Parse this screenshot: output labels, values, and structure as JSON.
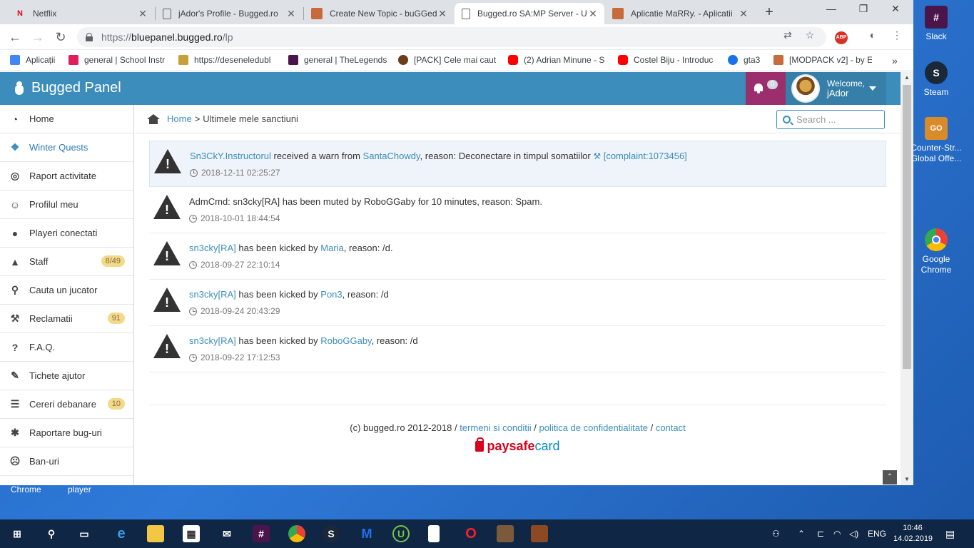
{
  "browser": {
    "tabs": [
      {
        "title": "Netflix",
        "favicon": "netflix-icon",
        "color": "#e50914",
        "active": false
      },
      {
        "title": "jAdor's Profile - Bugged.ro",
        "favicon": "page-icon",
        "color": "#5f6368",
        "active": false
      },
      {
        "title": "Create New Topic - buGGed",
        "favicon": "bugged-icon",
        "color": "#c86b3c",
        "active": false
      },
      {
        "title": "Bugged.ro SA:MP Server - U",
        "favicon": "page-icon",
        "color": "#5f6368",
        "active": true
      },
      {
        "title": "Aplicatie MaRRy. - Aplicatii",
        "favicon": "bugged-icon",
        "color": "#c86b3c",
        "active": false
      }
    ],
    "url_host": "bluepanel.bugged.ro",
    "url_path": "/lp",
    "url_scheme": "https://",
    "bookmarks": [
      {
        "label": "Aplicații",
        "color": "#4285f4"
      },
      {
        "label": "general | School Instr",
        "color": "#e01e5a"
      },
      {
        "label": "https://deseneledubl",
        "color": "#c8a03a"
      },
      {
        "label": "general | TheLegends",
        "color": "#4a154b"
      },
      {
        "label": "[PACK] Cele mai caut",
        "color": "#6b3d1a"
      },
      {
        "label": "(2) Adrian Minune - S",
        "color": "#ff0000"
      },
      {
        "label": "Costel Biju - Introduc",
        "color": "#ff0000"
      },
      {
        "label": "gta3",
        "color": "#1a73e8"
      },
      {
        "label": "[MODPACK v2] - by E",
        "color": "#c86b3c"
      }
    ]
  },
  "header": {
    "brand": "Bugged Panel",
    "notifications_count": "0",
    "welcome": "Welcome,",
    "username": "jAdor"
  },
  "sidebar": {
    "items": [
      {
        "label": "Home",
        "icon": "dashboard-icon",
        "glyph": "◔",
        "badge": ""
      },
      {
        "label": "Winter Quests",
        "icon": "dropbox-icon",
        "glyph": "❖",
        "badge": "",
        "active": true
      },
      {
        "label": "Raport activitate",
        "icon": "target-icon",
        "glyph": "◎",
        "badge": ""
      },
      {
        "label": "Profilul meu",
        "icon": "smile-icon",
        "glyph": "☺",
        "badge": ""
      },
      {
        "label": "Playeri conectati",
        "icon": "user-icon",
        "glyph": "●",
        "badge": ""
      },
      {
        "label": "Staff",
        "icon": "android-icon",
        "glyph": "▲",
        "badge": "8/49"
      },
      {
        "label": "Cauta un jucator",
        "icon": "search-icon",
        "glyph": "⚲",
        "badge": ""
      },
      {
        "label": "Reclamatii",
        "icon": "gavel-icon",
        "glyph": "⚒",
        "badge": "91"
      },
      {
        "label": "F.A.Q.",
        "icon": "question-icon",
        "glyph": "?",
        "badge": ""
      },
      {
        "label": "Tichete ajutor",
        "icon": "ticket-icon",
        "glyph": "✎",
        "badge": ""
      },
      {
        "label": "Cereri debanare",
        "icon": "list-icon",
        "glyph": "☰",
        "badge": "10"
      },
      {
        "label": "Raportare bug-uri",
        "icon": "bug-icon",
        "glyph": "✱",
        "badge": ""
      },
      {
        "label": "Ban-uri",
        "icon": "frown-icon",
        "glyph": "☹",
        "badge": ""
      }
    ]
  },
  "breadcrumb": {
    "home": "Home",
    "separator": ">",
    "current": "Ultimele mele sanctiuni"
  },
  "search": {
    "placeholder": "Search ..."
  },
  "entries": [
    {
      "pre_link": "Sn3CkY.Instructorul",
      "mid": " received a warn from ",
      "link2": "SantaChowdy",
      "post": ", reason: Deconectare in timpul somatiilor ",
      "complaint": "[complaint:1073456]",
      "time": "2018-12-11 02:25:27",
      "highlight": true
    },
    {
      "pre_link": "",
      "mid": "AdmCmd: sn3cky[RA] has been muted by RoboGGaby for 10 minutes, reason: Spam.",
      "link2": "",
      "post": "",
      "complaint": "",
      "time": "2018-10-01 18:44:54",
      "highlight": false
    },
    {
      "pre_link": "sn3cky[RA]",
      "mid": " has been kicked by ",
      "link2": "Maria",
      "post": ", reason: /d.",
      "complaint": "",
      "time": "2018-09-27 22:10:14",
      "highlight": false
    },
    {
      "pre_link": "sn3cky[RA]",
      "mid": " has been kicked by ",
      "link2": "Pon3",
      "post": ", reason: /d",
      "complaint": "",
      "time": "2018-09-24 20:43:29",
      "highlight": false
    },
    {
      "pre_link": "sn3cky[RA]",
      "mid": " has been kicked by ",
      "link2": "RoboGGaby",
      "post": ", reason: /d",
      "complaint": "",
      "time": "2018-09-22 17:12:53",
      "highlight": false
    }
  ],
  "footer": {
    "copyright": "(c) bugged.ro 2012-2018 / ",
    "terms": "termeni si conditii",
    "sep": " / ",
    "privacy": "politica de confidentialitate",
    "contact": "contact",
    "paysafe_a": "paysafe",
    "paysafe_b": "card"
  },
  "desktop": {
    "icons": [
      {
        "label": "Slack",
        "color": "#4a154b",
        "glyph": "#"
      },
      {
        "label": "Steam",
        "color": "#1b2838",
        "glyph": "S"
      },
      {
        "label": "Counter-Str... Global Offe...",
        "color": "#d98a2b",
        "glyph": "GO"
      },
      {
        "label": "Google Chrome",
        "color": "#ffffff",
        "glyph": "◉"
      }
    ],
    "under_window": [
      "Chrome",
      "player"
    ]
  },
  "taskbar": {
    "lang": "ENG",
    "time": "10:46",
    "date": "14.02.2019"
  },
  "colors": {
    "topbar": "#3c8dbc",
    "notif": "#9b2f6e",
    "link": "#3c8dbc"
  }
}
